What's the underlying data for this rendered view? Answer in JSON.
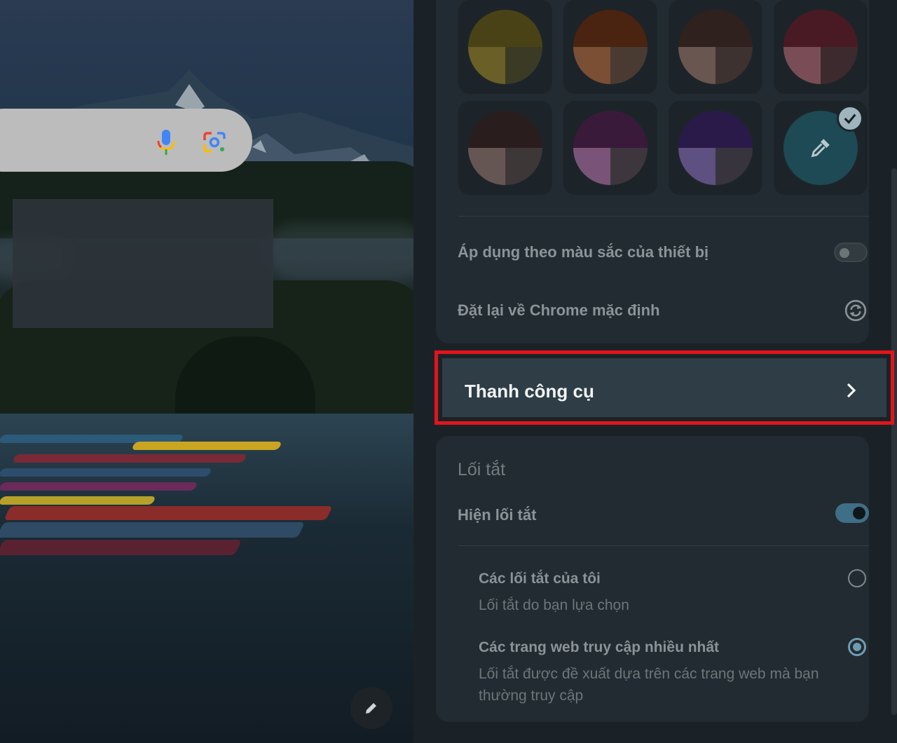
{
  "ntp": {
    "search_icons": [
      "mic-icon",
      "google-lens-icon"
    ],
    "edit_icon": "pencil-icon"
  },
  "colors": {
    "swatches": [
      {
        "name": "olive",
        "top": "#4a4217",
        "left": "#6a5f27",
        "right": "#3b3b25",
        "selected": false
      },
      {
        "name": "amber",
        "top": "#4a2410",
        "left": "#7a4f34",
        "right": "#4a3b32",
        "selected": false
      },
      {
        "name": "brown",
        "top": "#2f211e",
        "left": "#6a5650",
        "right": "#3d322f",
        "selected": false
      },
      {
        "name": "maroon",
        "top": "#4a1a24",
        "left": "#7a4d56",
        "right": "#3d2a2e",
        "selected": false
      },
      {
        "name": "mocha",
        "top": "#2a1d1e",
        "left": "#665653",
        "right": "#3d3737",
        "selected": false
      },
      {
        "name": "plum",
        "top": "#3a1a3a",
        "left": "#7a5478",
        "right": "#3d363c",
        "selected": false
      },
      {
        "name": "violet",
        "top": "#2a1a4a",
        "left": "#5e5080",
        "right": "#38343e",
        "selected": false
      },
      {
        "name": "custom",
        "fill": "#1d4a54",
        "icon": "eyedropper-icon",
        "badge_icon": "checkmark-icon",
        "selected": true
      }
    ],
    "apply_device_colors_label": "Áp dụng theo màu sắc của thiết bị",
    "apply_device_colors_on": false,
    "reset_label": "Đặt lại về Chrome mặc định",
    "reset_icon": "reset-icon"
  },
  "toolbar": {
    "label": "Thanh công cụ",
    "chevron_icon": "chevron-right-icon"
  },
  "shortcuts": {
    "heading": "Lối tắt",
    "show_label": "Hiện lối tắt",
    "show_on": true,
    "options": [
      {
        "title": "Các lối tắt của tôi",
        "subtitle": "Lối tắt do bạn lựa chọn",
        "selected": false
      },
      {
        "title": "Các trang web truy cập nhiều nhất",
        "subtitle": "Lối tắt được đề xuất dựa trên các trang web mà bạn thường truy cập",
        "selected": true
      }
    ]
  },
  "theme": {
    "highlight_border": "#e3141b",
    "accent": "#3f6f86",
    "panel_bg": "#1b2227",
    "card_bg": "#222b31"
  }
}
